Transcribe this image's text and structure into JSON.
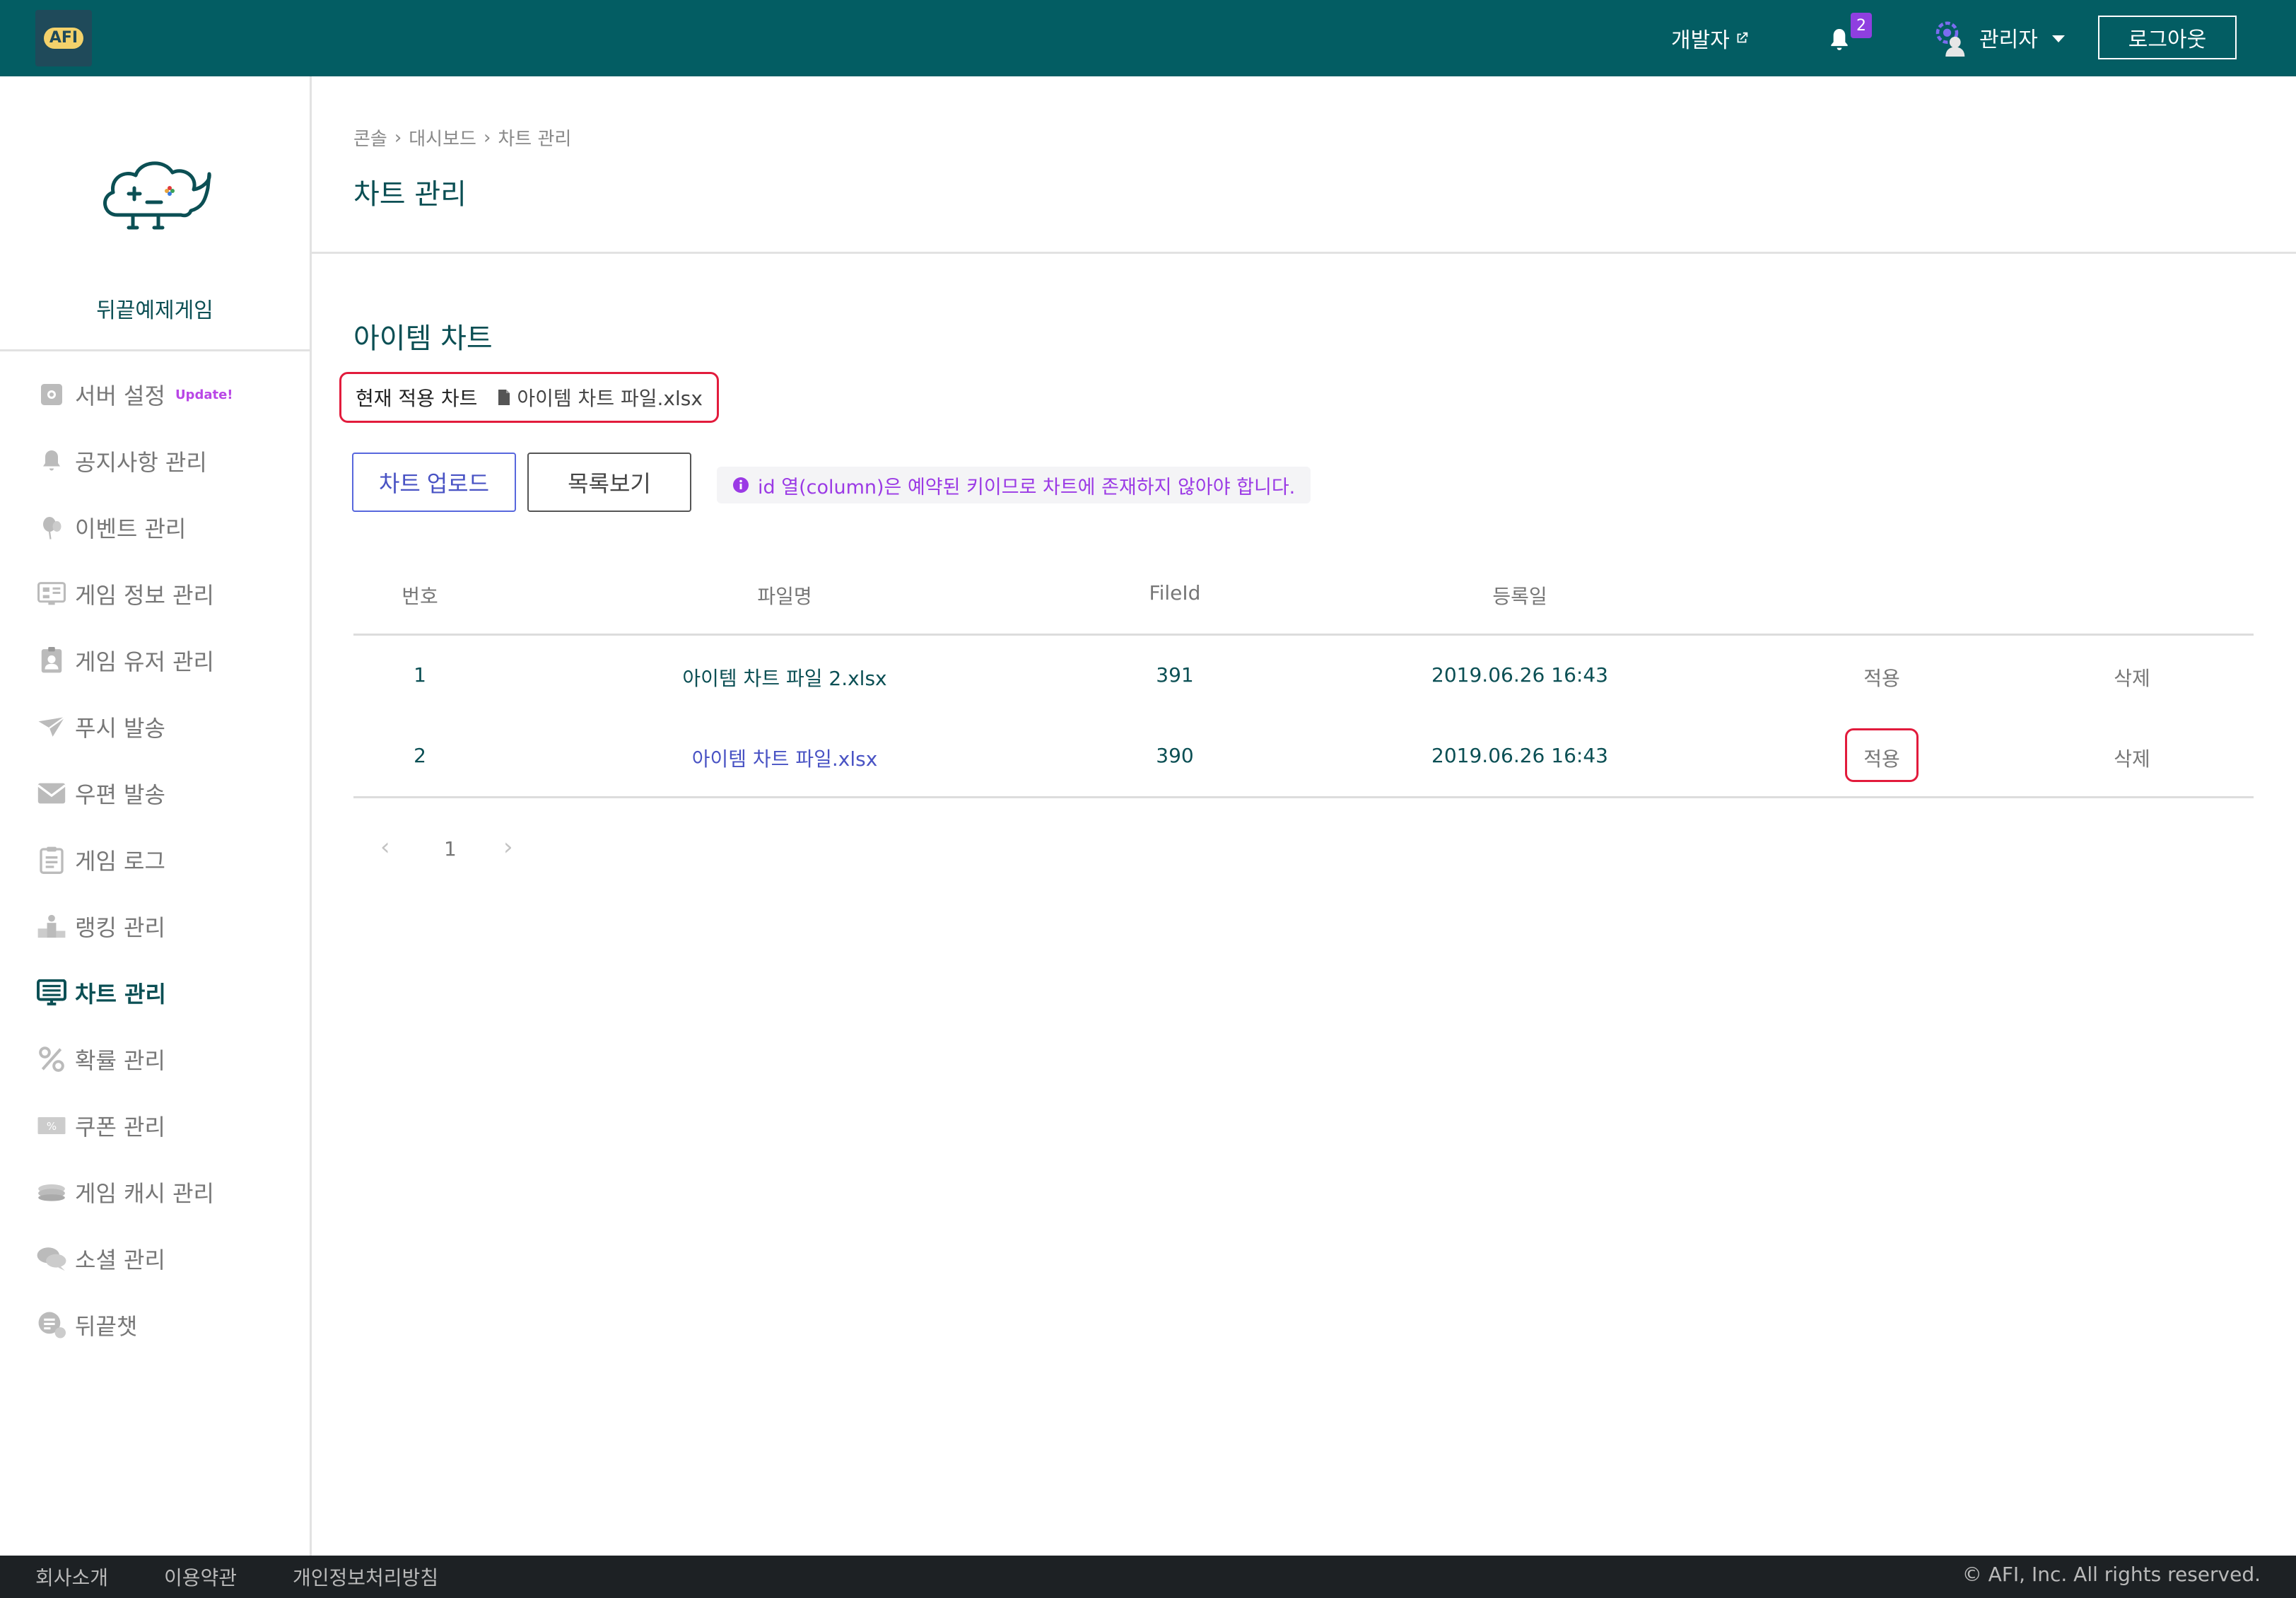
{
  "header": {
    "logo_text": "AFI",
    "developer_link": "개발자",
    "notification_count": "2",
    "admin_label": "관리자",
    "logout_label": "로그아웃"
  },
  "sidebar": {
    "game_name": "뒤끝예제게임",
    "update_badge": "Update!",
    "items": [
      {
        "label": "서버 설정",
        "icon": "gear-icon"
      },
      {
        "label": "공지사항 관리",
        "icon": "bell-icon"
      },
      {
        "label": "이벤트 관리",
        "icon": "balloon-icon"
      },
      {
        "label": "게임 정보 관리",
        "icon": "dashboard-icon"
      },
      {
        "label": "게임 유저 관리",
        "icon": "user-badge-icon"
      },
      {
        "label": "푸시 발송",
        "icon": "paper-plane-icon"
      },
      {
        "label": "우편 발송",
        "icon": "envelope-icon"
      },
      {
        "label": "게임 로그",
        "icon": "clipboard-icon"
      },
      {
        "label": "랭킹 관리",
        "icon": "podium-icon"
      },
      {
        "label": "차트 관리",
        "icon": "monitor-icon"
      },
      {
        "label": "확률 관리",
        "icon": "percent-icon"
      },
      {
        "label": "쿠폰 관리",
        "icon": "coupon-icon"
      },
      {
        "label": "게임 캐시 관리",
        "icon": "coins-icon"
      },
      {
        "label": "소셜 관리",
        "icon": "chat-bubbles-icon"
      },
      {
        "label": "뒤끝챗",
        "icon": "chat-icon"
      }
    ],
    "active_index": 9
  },
  "main": {
    "breadcrumb": [
      "콘솔",
      "대시보드",
      "차트 관리"
    ],
    "title": "차트 관리",
    "section_title": "아이템 차트",
    "current_chart_label": "현재 적용 차트",
    "current_chart_file": "아이템 차트 파일.xlsx",
    "upload_button": "차트 업로드",
    "list_button": "목록보기",
    "notice": "id 열(column)은 예약된 키이므로 차트에 존재하지 않아야 합니다.",
    "table": {
      "headers": [
        "번호",
        "파일명",
        "FileId",
        "등록일"
      ],
      "rows": [
        {
          "num": "1",
          "filename": "아이템 차트 파일 2.xlsx",
          "fileid": "391",
          "date": "2019.06.26 16:43",
          "apply": "적용",
          "delete": "삭제"
        },
        {
          "num": "2",
          "filename": "아이템 차트 파일.xlsx",
          "fileid": "390",
          "date": "2019.06.26 16:43",
          "apply": "적용",
          "delete": "삭제"
        }
      ]
    },
    "pagination": {
      "current": "1",
      "prev": "‹",
      "next": "›"
    }
  },
  "footer": {
    "links": [
      "회사소개",
      "이용약관",
      "개인정보처리방침"
    ],
    "copyright": "© AFI, Inc. All rights reserved."
  },
  "colors": {
    "header_bg": "#035d63",
    "accent_teal": "#0b4f54",
    "highlight_red": "#e21b3c",
    "notice_purple": "#9b3ae5",
    "link_blue": "#4953c4"
  }
}
